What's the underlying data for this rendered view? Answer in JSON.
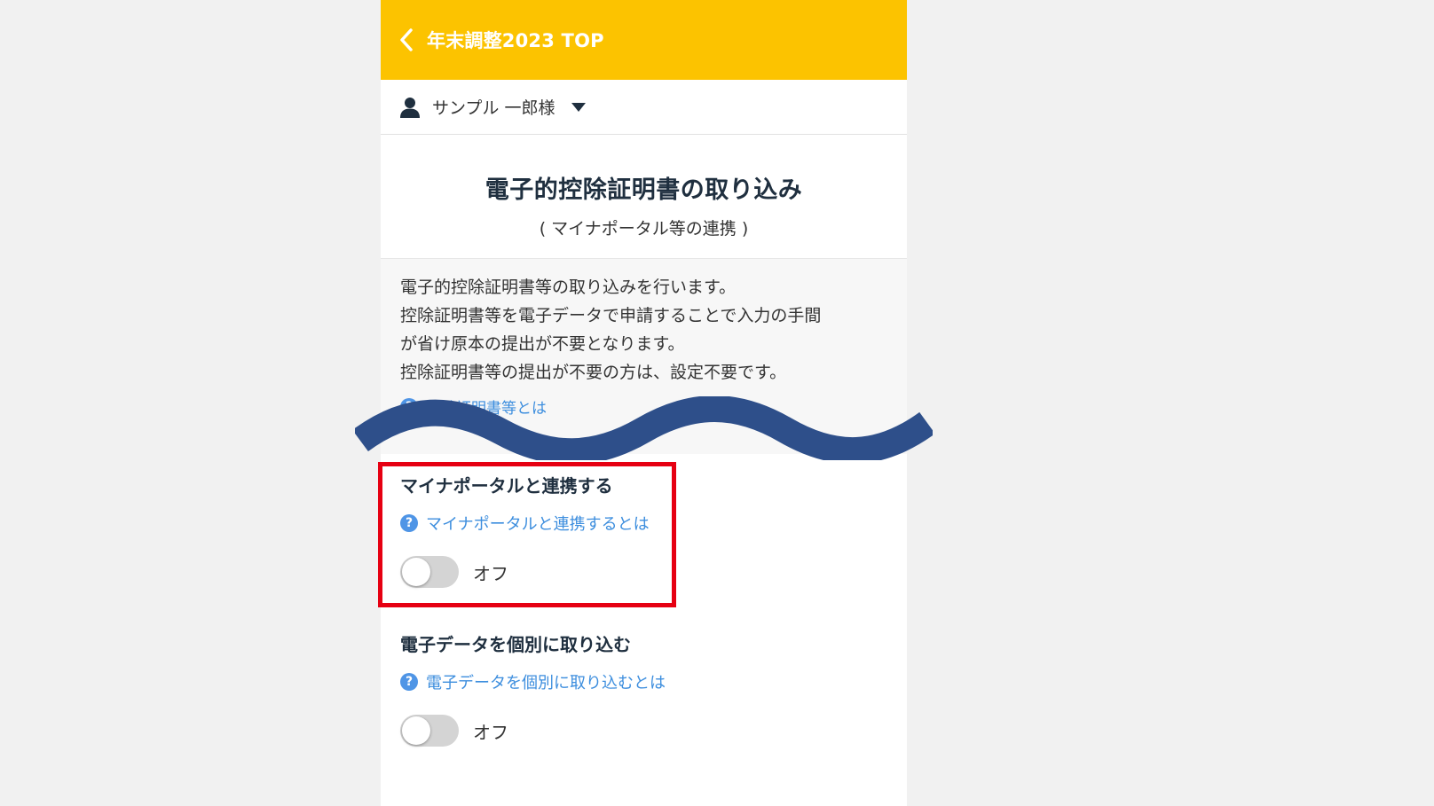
{
  "header": {
    "title": "年末調整2023 TOP",
    "background_color": "#fcc300",
    "back_icon": "chevron-left-icon"
  },
  "user": {
    "name": "サンプル 一郎様",
    "icon": "person-icon",
    "dropdown_icon": "caret-down-icon"
  },
  "page": {
    "title": "電子的控除証明書の取り込み",
    "subtitle": "( マイナポータル等の連携 )"
  },
  "description": {
    "lines": [
      "電子的控除証明書等の取り込みを行います。",
      "控除証明書等を電子データで申請することで入力の手間",
      "が省け原本の提出が不要となります。",
      "控除証明書等の提出が不要の方は、設定不要です。"
    ],
    "help_link_partial": "控除証明書等とは"
  },
  "sections": [
    {
      "heading": "マイナポータルと連携する",
      "help_link": "マイナポータルと連携するとは",
      "toggle_state": "オフ",
      "highlighted": true
    },
    {
      "heading": "電子データを個別に取り込む",
      "help_link": "電子データを個別に取り込むとは",
      "toggle_state": "オフ",
      "highlighted": false
    }
  ],
  "colors": {
    "link": "#3d8ede",
    "highlight": "#e60012",
    "wave": "#2e4f8a"
  },
  "help_icon_glyph": "?"
}
